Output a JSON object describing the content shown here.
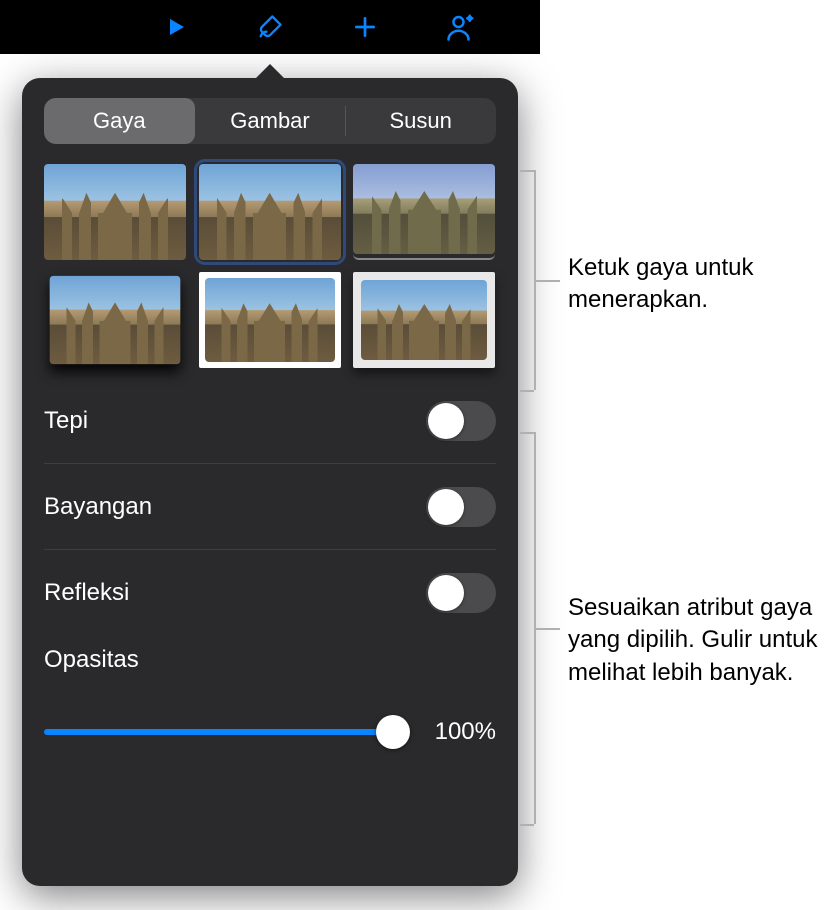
{
  "accent": "#0a84ff",
  "toolbar": {
    "icons": [
      "play-icon",
      "format-brush-icon",
      "add-icon",
      "add-people-icon"
    ]
  },
  "tabs": {
    "items": [
      "Gaya",
      "Gambar",
      "Susun"
    ],
    "active_index": 0
  },
  "style_grid": {
    "selected_index": 1,
    "count": 6
  },
  "toggles": [
    {
      "label": "Tepi",
      "value": false
    },
    {
      "label": "Bayangan",
      "value": false
    },
    {
      "label": "Refleksi",
      "value": false
    }
  ],
  "opacity": {
    "label": "Opasitas",
    "value_pct": 100,
    "display": "100%"
  },
  "callouts": {
    "styles": "Ketuk gaya untuk menerapkan.",
    "adjust": "Sesuaikan atribut gaya yang dipilih. Gulir untuk melihat lebih banyak."
  }
}
